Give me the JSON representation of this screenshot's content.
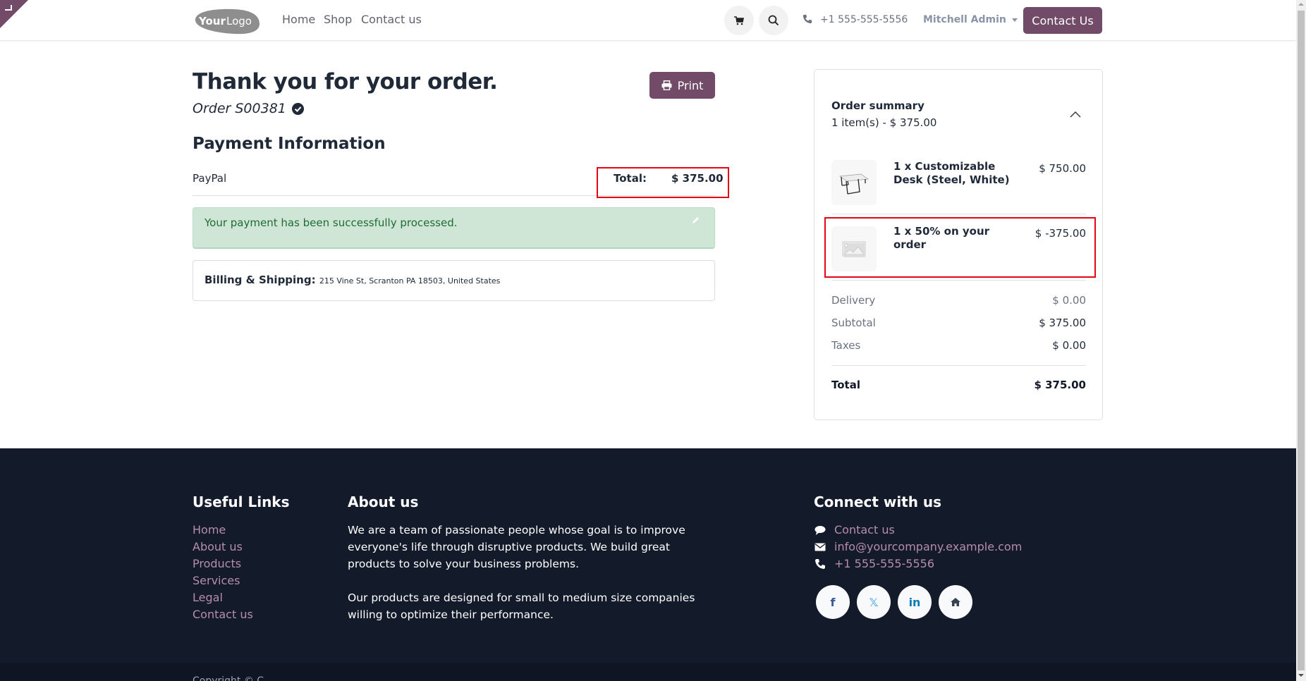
{
  "header": {
    "logo_text": "YourLogo",
    "nav": [
      {
        "label": "Home"
      },
      {
        "label": "Shop"
      },
      {
        "label": "Contact us"
      }
    ],
    "cart_icon": "shopping-cart-icon",
    "search_icon": "search-icon",
    "phone": "+1 555-555-5556",
    "user": "Mitchell Admin",
    "cta_label": "Contact Us"
  },
  "main": {
    "title": "Thank you for your order.",
    "order_ref": "Order S00381",
    "print_label": "Print",
    "payment_heading": "Payment Information",
    "payment_method": "PayPal",
    "total_label": "Total:",
    "total_value": "$ 375.00",
    "alert": "Your payment has been successfully processed.",
    "billing_label": "Billing & Shipping:",
    "billing_value": "215 Vine St, Scranton PA 18503, United States"
  },
  "summary": {
    "title": "Order summary",
    "subtitle": "1 item(s) -  $ 375.00",
    "items": [
      {
        "name": "1 x Customizable Desk (Steel, White)",
        "price": "$ 750.00",
        "thumb": "desk-image"
      },
      {
        "name": "1 x 50% on your order",
        "price": "$ -375.00",
        "thumb": "placeholder-image"
      }
    ],
    "rows": [
      {
        "label": "Delivery",
        "value": "$ 0.00"
      },
      {
        "label": "Subtotal",
        "value": "$ 375.00"
      },
      {
        "label": "Taxes",
        "value": "$ 0.00"
      }
    ],
    "total_label": "Total",
    "total_value": "$ 375.00"
  },
  "footer": {
    "useful_links_heading": "Useful Links",
    "useful_links": [
      "Home",
      "About us",
      "Products",
      "Services",
      "Legal",
      "Contact us"
    ],
    "about_heading": "About us",
    "about_p1": "We are a team of passionate people whose goal is to improve everyone's life through disruptive products. We build great products to solve your business problems.",
    "about_p2": "Our products are designed for small to medium size companies willing to optimize their performance.",
    "connect_heading": "Connect with us",
    "contact_link": "Contact us",
    "email": "info@yourcompany.example.com",
    "phone": "+1 555-555-5556",
    "social": [
      {
        "name": "facebook",
        "glyph": "f",
        "color": "#3b5998"
      },
      {
        "name": "x-twitter",
        "glyph": "𝕏",
        "color": "#5aaef0"
      },
      {
        "name": "linkedin",
        "glyph": "in",
        "color": "#0a7ab8"
      },
      {
        "name": "home",
        "glyph": "⌂",
        "color": "#374151"
      }
    ],
    "copyright": "Copyright © C"
  },
  "colors": {
    "brand": "#714b67",
    "footer_bg": "#131a2a",
    "footer_link": "#b68dad",
    "alert_bg": "#cfe6d6",
    "alert_text": "#1e6c33",
    "highlight": "#e30613"
  }
}
